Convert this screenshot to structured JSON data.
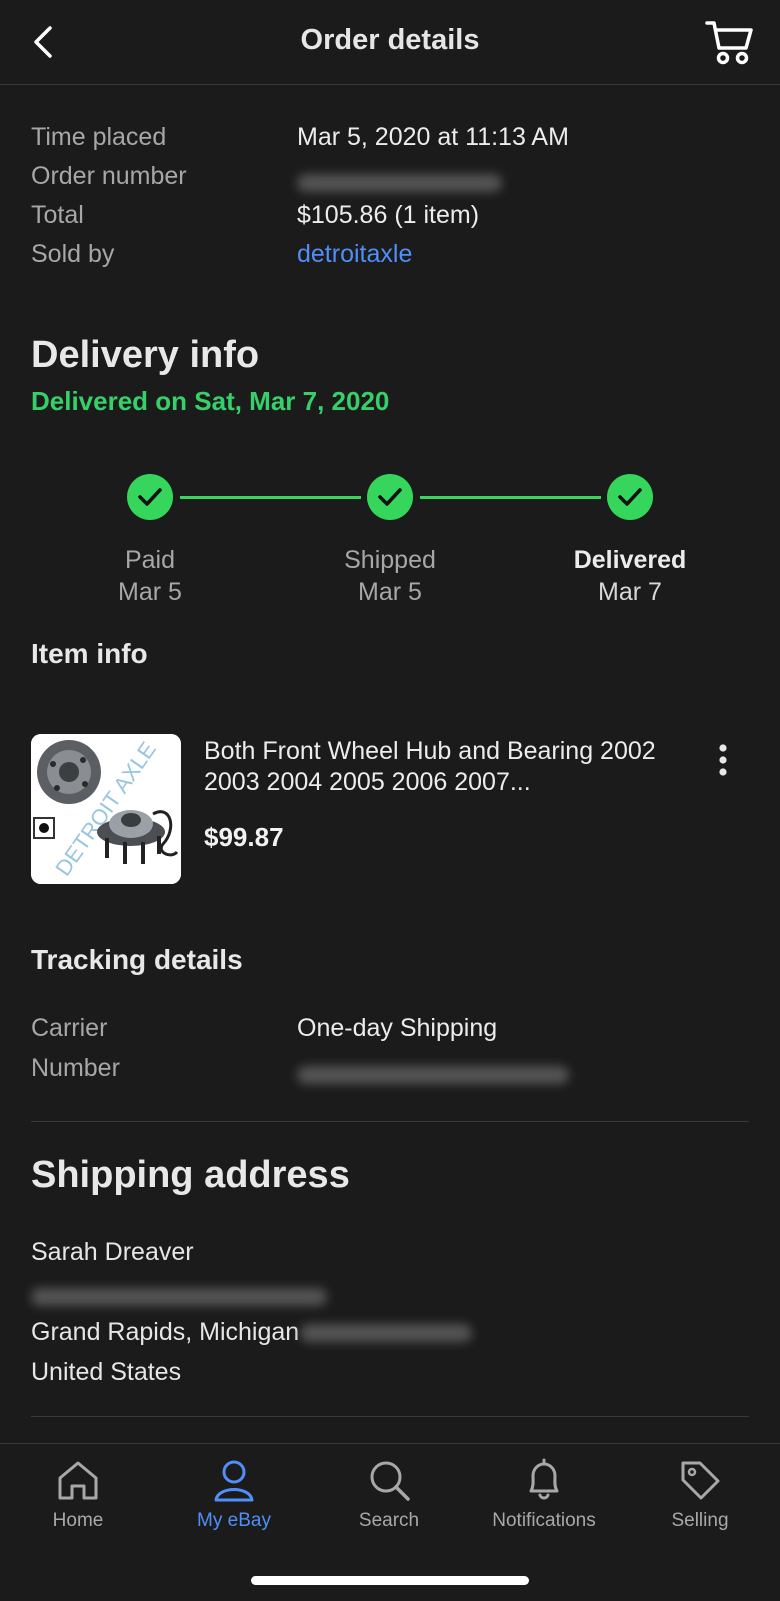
{
  "header": {
    "title": "Order details",
    "back_icon": "chevron-left-icon",
    "cart_icon": "cart-icon"
  },
  "order": {
    "time_placed_label": "Time placed",
    "time_placed_value": "Mar 5, 2020 at 11:13 AM",
    "order_number_label": "Order number",
    "total_label": "Total",
    "total_value": "$105.86 (1 item)",
    "sold_by_label": "Sold by",
    "sold_by_value": "detroitaxle"
  },
  "delivery": {
    "heading": "Delivery info",
    "status": "Delivered on Sat, Mar 7, 2020",
    "steps": [
      {
        "label": "Paid",
        "date": "Mar 5"
      },
      {
        "label": "Shipped",
        "date": "Mar 5"
      },
      {
        "label": "Delivered",
        "date": "Mar 7"
      }
    ]
  },
  "item": {
    "heading": "Item info",
    "title": "Both Front Wheel Hub and Bearing 2002 2003 2004 2005 2006 2007...",
    "price": "$99.87",
    "image_watermark": "DETROIT AXLE"
  },
  "tracking": {
    "heading": "Tracking details",
    "carrier_label": "Carrier",
    "carrier_value": "One-day Shipping",
    "number_label": "Number"
  },
  "shipping": {
    "heading": "Shipping address",
    "name": "Sarah Dreaver",
    "city_line": "Grand Rapids, Michigan",
    "country": "United States"
  },
  "tabbar": {
    "tabs": [
      {
        "label": "Home",
        "icon": "home-icon",
        "active": false
      },
      {
        "label": "My eBay",
        "icon": "person-icon",
        "active": true
      },
      {
        "label": "Search",
        "icon": "search-icon",
        "active": false
      },
      {
        "label": "Notifications",
        "icon": "bell-icon",
        "active": false
      },
      {
        "label": "Selling",
        "icon": "tag-icon",
        "active": false
      }
    ]
  },
  "colors": {
    "background": "#1b1b1b",
    "accent_green": "#36d65c",
    "link_blue": "#4f8ff7"
  }
}
